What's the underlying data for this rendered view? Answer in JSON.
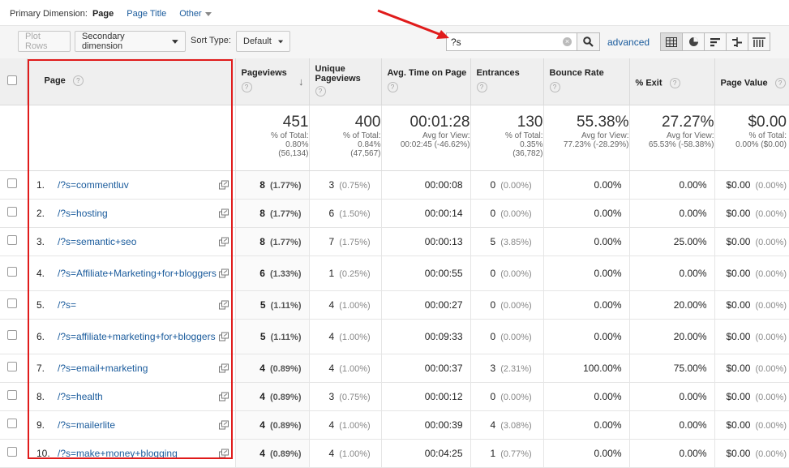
{
  "primary": {
    "label": "Primary Dimension:",
    "active": "Page",
    "page_title": "Page Title",
    "other": "Other"
  },
  "toolbar": {
    "plot_rows": "Plot Rows",
    "secondary_dimension": "Secondary dimension",
    "sort_type_label": "Sort Type:",
    "sort_type_value": "Default",
    "search_value": "?s",
    "advanced": "advanced"
  },
  "views": [
    "data-table-icon",
    "pie-chart-icon",
    "performance-icon",
    "comparison-icon",
    "pivot-icon"
  ],
  "columns": {
    "page": "Page",
    "pageviews": "Pageviews",
    "unique_pageviews": "Unique Pageviews",
    "avg_time": "Avg. Time on Page",
    "entrances": "Entrances",
    "bounce_rate": "Bounce Rate",
    "exit": "% Exit",
    "page_value": "Page Value"
  },
  "totals": {
    "pageviews": {
      "value": "451",
      "line1": "% of Total:",
      "line2": "0.80%",
      "line3": "(56,134)"
    },
    "unique_pageviews": {
      "value": "400",
      "line1": "% of Total:",
      "line2": "0.84%",
      "line3": "(47,567)"
    },
    "avg_time": {
      "value": "00:01:28",
      "line1": "Avg for View:",
      "line2": "00:02:45 (-46.62%)",
      "line3": ""
    },
    "entrances": {
      "value": "130",
      "line1": "% of Total:",
      "line2": "0.35%",
      "line3": "(36,782)"
    },
    "bounce_rate": {
      "value": "55.38%",
      "line1": "Avg for View:",
      "line2": "77.23% (-28.29%)",
      "line3": ""
    },
    "exit": {
      "value": "27.27%",
      "line1": "Avg for View:",
      "line2": "65.53% (-58.38%)",
      "line3": ""
    },
    "page_value": {
      "value": "$0.00",
      "line1": "% of Total:",
      "line2": "0.00% ($0.00)",
      "line3": ""
    }
  },
  "rows": [
    {
      "num": "1.",
      "page": "/?s=commentluv",
      "pv": "8",
      "pv_pct": "(1.77%)",
      "upv": "3",
      "upv_pct": "(0.75%)",
      "time": "00:00:08",
      "ent": "0",
      "ent_pct": "(0.00%)",
      "bounce": "0.00%",
      "exit": "0.00%",
      "value": "$0.00",
      "value_pct": "(0.00%)"
    },
    {
      "num": "2.",
      "page": "/?s=hosting",
      "pv": "8",
      "pv_pct": "(1.77%)",
      "upv": "6",
      "upv_pct": "(1.50%)",
      "time": "00:00:14",
      "ent": "0",
      "ent_pct": "(0.00%)",
      "bounce": "0.00%",
      "exit": "0.00%",
      "value": "$0.00",
      "value_pct": "(0.00%)"
    },
    {
      "num": "3.",
      "page": "/?s=semantic+seo",
      "pv": "8",
      "pv_pct": "(1.77%)",
      "upv": "7",
      "upv_pct": "(1.75%)",
      "time": "00:00:13",
      "ent": "5",
      "ent_pct": "(3.85%)",
      "bounce": "0.00%",
      "exit": "25.00%",
      "value": "$0.00",
      "value_pct": "(0.00%)"
    },
    {
      "num": "4.",
      "page": "/?s=Affiliate+Marketing+for+bloggers",
      "pv": "6",
      "pv_pct": "(1.33%)",
      "upv": "1",
      "upv_pct": "(0.25%)",
      "time": "00:00:55",
      "ent": "0",
      "ent_pct": "(0.00%)",
      "bounce": "0.00%",
      "exit": "0.00%",
      "value": "$0.00",
      "value_pct": "(0.00%)"
    },
    {
      "num": "5.",
      "page": "/?s=",
      "pv": "5",
      "pv_pct": "(1.11%)",
      "upv": "4",
      "upv_pct": "(1.00%)",
      "time": "00:00:27",
      "ent": "0",
      "ent_pct": "(0.00%)",
      "bounce": "0.00%",
      "exit": "20.00%",
      "value": "$0.00",
      "value_pct": "(0.00%)"
    },
    {
      "num": "6.",
      "page": "/?s=affiliate+marketing+for+bloggers",
      "pv": "5",
      "pv_pct": "(1.11%)",
      "upv": "4",
      "upv_pct": "(1.00%)",
      "time": "00:09:33",
      "ent": "0",
      "ent_pct": "(0.00%)",
      "bounce": "0.00%",
      "exit": "20.00%",
      "value": "$0.00",
      "value_pct": "(0.00%)"
    },
    {
      "num": "7.",
      "page": "/?s=email+marketing",
      "pv": "4",
      "pv_pct": "(0.89%)",
      "upv": "4",
      "upv_pct": "(1.00%)",
      "time": "00:00:37",
      "ent": "3",
      "ent_pct": "(2.31%)",
      "bounce": "100.00%",
      "exit": "75.00%",
      "value": "$0.00",
      "value_pct": "(0.00%)"
    },
    {
      "num": "8.",
      "page": "/?s=health",
      "pv": "4",
      "pv_pct": "(0.89%)",
      "upv": "3",
      "upv_pct": "(0.75%)",
      "time": "00:00:12",
      "ent": "0",
      "ent_pct": "(0.00%)",
      "bounce": "0.00%",
      "exit": "0.00%",
      "value": "$0.00",
      "value_pct": "(0.00%)"
    },
    {
      "num": "9.",
      "page": "/?s=mailerlite",
      "pv": "4",
      "pv_pct": "(0.89%)",
      "upv": "4",
      "upv_pct": "(1.00%)",
      "time": "00:00:39",
      "ent": "4",
      "ent_pct": "(3.08%)",
      "bounce": "0.00%",
      "exit": "0.00%",
      "value": "$0.00",
      "value_pct": "(0.00%)"
    },
    {
      "num": "10.",
      "page": "/?s=make+money+blogging",
      "pv": "4",
      "pv_pct": "(0.89%)",
      "upv": "4",
      "upv_pct": "(1.00%)",
      "time": "00:04:25",
      "ent": "1",
      "ent_pct": "(0.77%)",
      "bounce": "0.00%",
      "exit": "0.00%",
      "value": "$0.00",
      "value_pct": "(0.00%)"
    }
  ],
  "colors": {
    "link": "#1a5b9c",
    "highlight": "#e01b1b",
    "header_bg": "#efefef"
  }
}
